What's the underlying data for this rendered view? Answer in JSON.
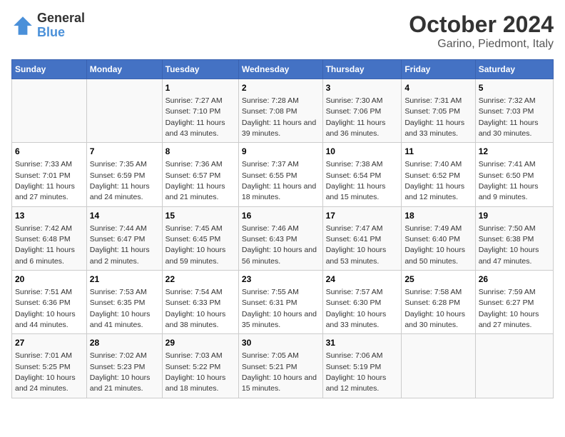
{
  "logo": {
    "general": "General",
    "blue": "Blue"
  },
  "title": "October 2024",
  "subtitle": "Garino, Piedmont, Italy",
  "days_of_week": [
    "Sunday",
    "Monday",
    "Tuesday",
    "Wednesday",
    "Thursday",
    "Friday",
    "Saturday"
  ],
  "weeks": [
    [
      {
        "day": "",
        "info": ""
      },
      {
        "day": "",
        "info": ""
      },
      {
        "day": "1",
        "info": "Sunrise: 7:27 AM\nSunset: 7:10 PM\nDaylight: 11 hours and 43 minutes."
      },
      {
        "day": "2",
        "info": "Sunrise: 7:28 AM\nSunset: 7:08 PM\nDaylight: 11 hours and 39 minutes."
      },
      {
        "day": "3",
        "info": "Sunrise: 7:30 AM\nSunset: 7:06 PM\nDaylight: 11 hours and 36 minutes."
      },
      {
        "day": "4",
        "info": "Sunrise: 7:31 AM\nSunset: 7:05 PM\nDaylight: 11 hours and 33 minutes."
      },
      {
        "day": "5",
        "info": "Sunrise: 7:32 AM\nSunset: 7:03 PM\nDaylight: 11 hours and 30 minutes."
      }
    ],
    [
      {
        "day": "6",
        "info": "Sunrise: 7:33 AM\nSunset: 7:01 PM\nDaylight: 11 hours and 27 minutes."
      },
      {
        "day": "7",
        "info": "Sunrise: 7:35 AM\nSunset: 6:59 PM\nDaylight: 11 hours and 24 minutes."
      },
      {
        "day": "8",
        "info": "Sunrise: 7:36 AM\nSunset: 6:57 PM\nDaylight: 11 hours and 21 minutes."
      },
      {
        "day": "9",
        "info": "Sunrise: 7:37 AM\nSunset: 6:55 PM\nDaylight: 11 hours and 18 minutes."
      },
      {
        "day": "10",
        "info": "Sunrise: 7:38 AM\nSunset: 6:54 PM\nDaylight: 11 hours and 15 minutes."
      },
      {
        "day": "11",
        "info": "Sunrise: 7:40 AM\nSunset: 6:52 PM\nDaylight: 11 hours and 12 minutes."
      },
      {
        "day": "12",
        "info": "Sunrise: 7:41 AM\nSunset: 6:50 PM\nDaylight: 11 hours and 9 minutes."
      }
    ],
    [
      {
        "day": "13",
        "info": "Sunrise: 7:42 AM\nSunset: 6:48 PM\nDaylight: 11 hours and 6 minutes."
      },
      {
        "day": "14",
        "info": "Sunrise: 7:44 AM\nSunset: 6:47 PM\nDaylight: 11 hours and 2 minutes."
      },
      {
        "day": "15",
        "info": "Sunrise: 7:45 AM\nSunset: 6:45 PM\nDaylight: 10 hours and 59 minutes."
      },
      {
        "day": "16",
        "info": "Sunrise: 7:46 AM\nSunset: 6:43 PM\nDaylight: 10 hours and 56 minutes."
      },
      {
        "day": "17",
        "info": "Sunrise: 7:47 AM\nSunset: 6:41 PM\nDaylight: 10 hours and 53 minutes."
      },
      {
        "day": "18",
        "info": "Sunrise: 7:49 AM\nSunset: 6:40 PM\nDaylight: 10 hours and 50 minutes."
      },
      {
        "day": "19",
        "info": "Sunrise: 7:50 AM\nSunset: 6:38 PM\nDaylight: 10 hours and 47 minutes."
      }
    ],
    [
      {
        "day": "20",
        "info": "Sunrise: 7:51 AM\nSunset: 6:36 PM\nDaylight: 10 hours and 44 minutes."
      },
      {
        "day": "21",
        "info": "Sunrise: 7:53 AM\nSunset: 6:35 PM\nDaylight: 10 hours and 41 minutes."
      },
      {
        "day": "22",
        "info": "Sunrise: 7:54 AM\nSunset: 6:33 PM\nDaylight: 10 hours and 38 minutes."
      },
      {
        "day": "23",
        "info": "Sunrise: 7:55 AM\nSunset: 6:31 PM\nDaylight: 10 hours and 35 minutes."
      },
      {
        "day": "24",
        "info": "Sunrise: 7:57 AM\nSunset: 6:30 PM\nDaylight: 10 hours and 33 minutes."
      },
      {
        "day": "25",
        "info": "Sunrise: 7:58 AM\nSunset: 6:28 PM\nDaylight: 10 hours and 30 minutes."
      },
      {
        "day": "26",
        "info": "Sunrise: 7:59 AM\nSunset: 6:27 PM\nDaylight: 10 hours and 27 minutes."
      }
    ],
    [
      {
        "day": "27",
        "info": "Sunrise: 7:01 AM\nSunset: 5:25 PM\nDaylight: 10 hours and 24 minutes."
      },
      {
        "day": "28",
        "info": "Sunrise: 7:02 AM\nSunset: 5:23 PM\nDaylight: 10 hours and 21 minutes."
      },
      {
        "day": "29",
        "info": "Sunrise: 7:03 AM\nSunset: 5:22 PM\nDaylight: 10 hours and 18 minutes."
      },
      {
        "day": "30",
        "info": "Sunrise: 7:05 AM\nSunset: 5:21 PM\nDaylight: 10 hours and 15 minutes."
      },
      {
        "day": "31",
        "info": "Sunrise: 7:06 AM\nSunset: 5:19 PM\nDaylight: 10 hours and 12 minutes."
      },
      {
        "day": "",
        "info": ""
      },
      {
        "day": "",
        "info": ""
      }
    ]
  ]
}
